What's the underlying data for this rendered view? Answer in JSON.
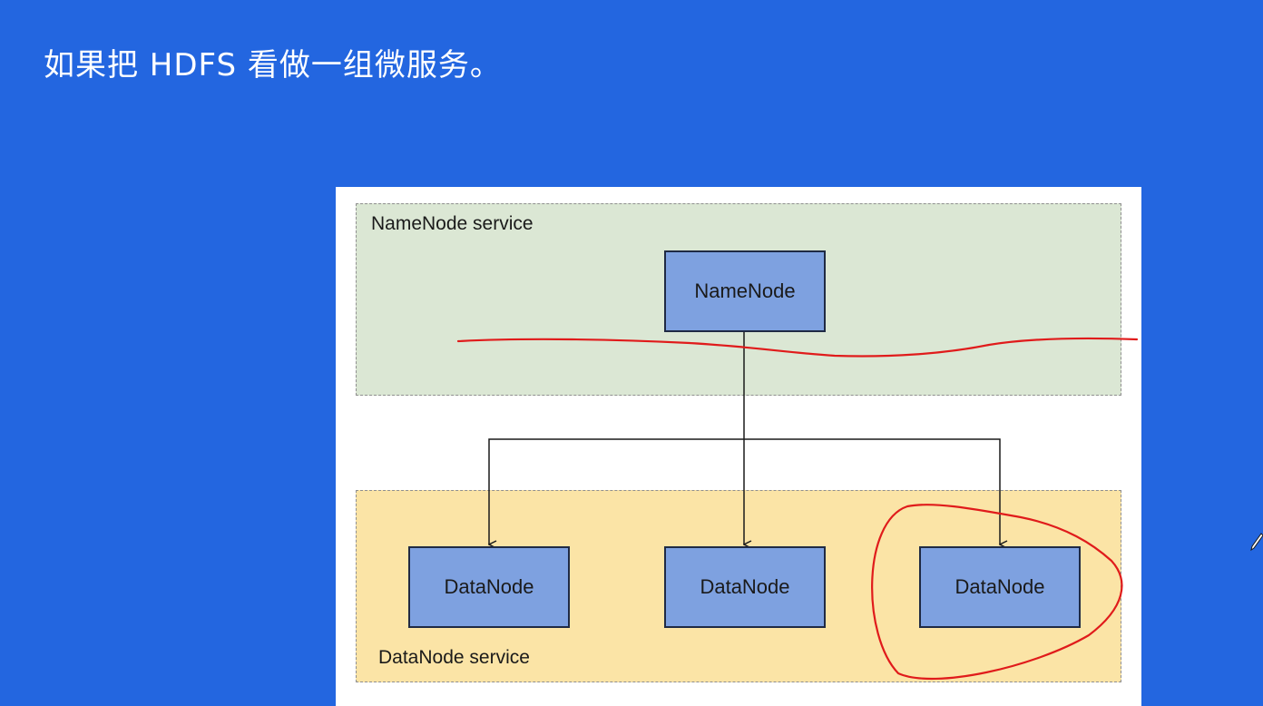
{
  "slide": {
    "title": "如果把 HDFS 看做一组微服务。"
  },
  "diagram": {
    "namenode_service": {
      "label": "NameNode service",
      "nodes": [
        "NameNode"
      ]
    },
    "datanode_service": {
      "label": "DataNode service",
      "nodes": [
        "DataNode",
        "DataNode",
        "DataNode"
      ]
    }
  },
  "colors": {
    "background": "#2366e0",
    "namenode_service_fill": "#dbe7d4",
    "datanode_service_fill": "#fbe4a6",
    "node_fill": "#7ea1e0",
    "annotation": "#e01b1b"
  },
  "icons": {
    "cursor": "pen-cursor-icon"
  }
}
